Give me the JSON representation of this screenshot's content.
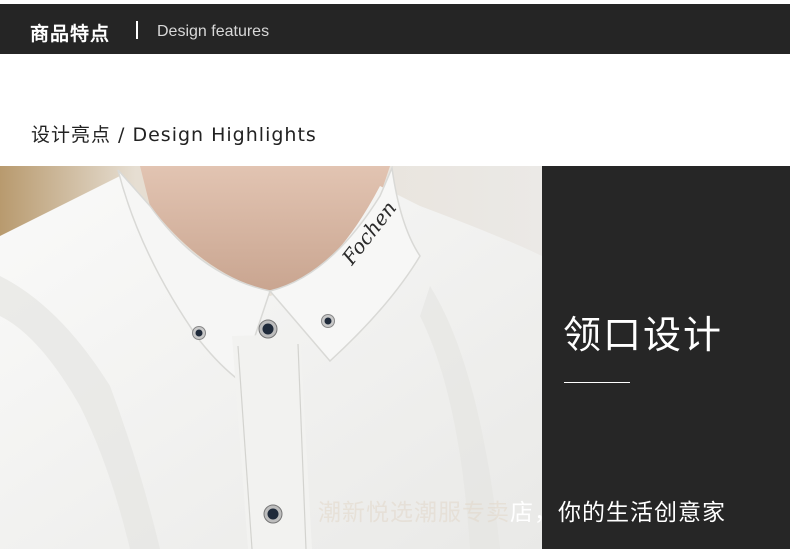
{
  "header": {
    "title_cn": "商品特点",
    "title_en": "Design features"
  },
  "subtitle": "设计亮点 / Design Highlights",
  "photo": {
    "collar_embroidery": "Fochen"
  },
  "panel": {
    "title": "领口设计"
  },
  "watermark": {
    "faded_text": "潮新悦选潮服专卖",
    "solid_text": "店，你的生活创意家"
  },
  "colors": {
    "header_bg": "#252525",
    "panel_bg": "#262626",
    "shirt": "#f4f4f2",
    "skin": "#d8b9a6",
    "button": "#1f2a3a"
  }
}
